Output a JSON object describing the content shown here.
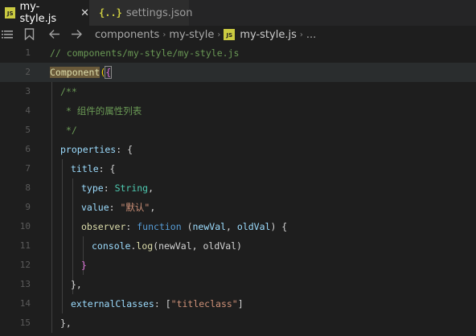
{
  "tabs": [
    {
      "icon": "JS",
      "label": "my-style.js",
      "close": "✕"
    },
    {
      "icon": "{..}",
      "label": "settings.json"
    }
  ],
  "breadcrumb": {
    "items": [
      "components",
      "my-style"
    ],
    "file_icon": "JS",
    "file": "my-style.js",
    "more": "..."
  },
  "line_numbers": [
    "1",
    "2",
    "3",
    "4",
    "5",
    "6",
    "7",
    "8",
    "9",
    "10",
    "11",
    "12",
    "13",
    "14",
    "15"
  ],
  "code": {
    "l1": "// components/my-style/my-style.js",
    "l2_fn": "Component",
    "l2_p": "(",
    "l2_b": "{",
    "l3": "/**",
    "l4": " * 组件的属性列表",
    "l5": " */",
    "l6_key": "properties",
    "l6_rest": ": {",
    "l7_key": "title",
    "l7_rest": ": {",
    "l8_key": "type",
    "l8_colon": ": ",
    "l8_val": "String",
    "l8_comma": ",",
    "l9_key": "value",
    "l9_colon": ": ",
    "l9_val": "\"默认\"",
    "l9_comma": ",",
    "l10_key": "observer",
    "l10_colon": ": ",
    "l10_kw": "function",
    "l10_open": " (",
    "l10_p1": "newVal",
    "l10_sep": ", ",
    "l10_p2": "oldVal",
    "l10_close": ") {",
    "l11_obj": "console",
    "l11_dot": ".",
    "l11_fn": "log",
    "l11_args": "(newVal, oldVal)",
    "l12": "}",
    "l13": "},",
    "l14_key": "externalClasses",
    "l14_colon": ": [",
    "l14_val": "\"titleclass\"",
    "l14_close": "]",
    "l15": "},"
  },
  "colors": {
    "background": "#1e1e1e",
    "comment": "#6a9955",
    "function": "#dcdcaa",
    "keyword": "#569cd6",
    "property": "#9cdcfe",
    "type": "#4ec9b0",
    "string": "#ce9178"
  }
}
